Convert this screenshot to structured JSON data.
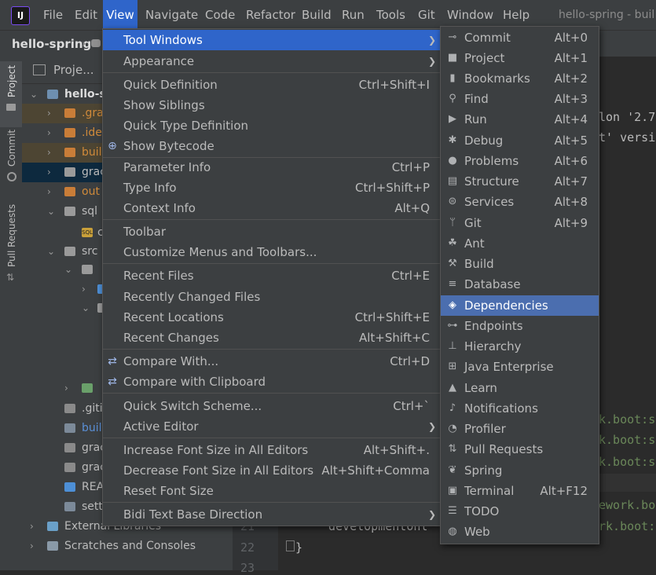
{
  "window": {
    "title": "hello-spring - buil"
  },
  "menubar": {
    "items": [
      {
        "label": "File"
      },
      {
        "label": "Edit"
      },
      {
        "label": "View"
      },
      {
        "label": "Navigate"
      },
      {
        "label": "Code"
      },
      {
        "label": "Refactor"
      },
      {
        "label": "Build"
      },
      {
        "label": "Run"
      },
      {
        "label": "Tools"
      },
      {
        "label": "Git"
      },
      {
        "label": "Window"
      },
      {
        "label": "Help"
      }
    ]
  },
  "navbar": {
    "project": "hello-spring"
  },
  "left_strip": {
    "project": "Project",
    "commit": "Commit",
    "pull_requests": "Pull Requests"
  },
  "project_pane": {
    "title": "Proje...",
    "rows": [
      {
        "label": "hello-s",
        "color": "#dcdcdc"
      },
      {
        "label": ".gra",
        "color": "#d08a3a"
      },
      {
        "label": ".ide",
        "color": "#d08a3a"
      },
      {
        "label": "buil",
        "color": "#d08a3a"
      },
      {
        "label": "grac",
        "color": "#bbbbbb"
      },
      {
        "label": "out",
        "color": "#d08a3a"
      },
      {
        "label": "sql",
        "color": "#bbbbbb"
      },
      {
        "label": "c",
        "color": "#bbbbbb"
      },
      {
        "label": "src",
        "color": "#bbbbbb"
      },
      {
        "label": ".giti",
        "color": "#bbbbbb"
      },
      {
        "label": "buil",
        "color": "#5a8fd6"
      },
      {
        "label": "grac",
        "color": "#bbbbbb"
      },
      {
        "label": "grac",
        "color": "#bbbbbb"
      },
      {
        "label": "REA",
        "color": "#bbbbbb"
      },
      {
        "label": "sett",
        "color": "#bbbbbb"
      },
      {
        "label": "External Libraries",
        "color": "#bbbbbb"
      },
      {
        "label": "Scratches and Consoles",
        "color": "#bbbbbb"
      }
    ]
  },
  "editor": {
    "line_numbers": [
      "21",
      "22",
      "23"
    ],
    "fragments": [
      {
        "text": "lon '2.7",
        "color": "#bbbbbb"
      },
      {
        "text": "t' versi",
        "color": "#bbbbbb"
      },
      {
        "text": "k.boot:s",
        "color": "#6a8759"
      },
      {
        "text": "k.boot:s",
        "color": "#6a8759"
      },
      {
        "text": "k.boot:s",
        "color": "#6a8759"
      },
      {
        "text": "ework.bo",
        "color": "#6a8759"
      },
      {
        "text": "developmentOnl",
        "color": "#bbbbbb"
      },
      {
        "text": "rk.boot:",
        "color": "#6a8759"
      },
      {
        "text": "}",
        "color": "#bbbbbb"
      }
    ]
  },
  "view_menu": {
    "items": [
      {
        "label": "Tool Windows",
        "shortcut": "",
        "submenu": true,
        "selected": true
      },
      {
        "label": "Appearance",
        "shortcut": "",
        "submenu": true
      },
      {
        "label": "Quick Definition",
        "shortcut": "Ctrl+Shift+I"
      },
      {
        "label": "Show Siblings",
        "shortcut": ""
      },
      {
        "label": "Quick Type Definition",
        "shortcut": ""
      },
      {
        "label": "Show Bytecode",
        "shortcut": "",
        "icon": "bytecode-icon"
      },
      {
        "label": "Parameter Info",
        "shortcut": "Ctrl+P"
      },
      {
        "label": "Type Info",
        "shortcut": "Ctrl+Shift+P"
      },
      {
        "label": "Context Info",
        "shortcut": "Alt+Q"
      },
      {
        "label": "Toolbar",
        "shortcut": ""
      },
      {
        "label": "Customize Menus and Toolbars...",
        "shortcut": ""
      },
      {
        "label": "Recent Files",
        "shortcut": "Ctrl+E"
      },
      {
        "label": "Recently Changed Files",
        "shortcut": ""
      },
      {
        "label": "Recent Locations",
        "shortcut": "Ctrl+Shift+E"
      },
      {
        "label": "Recent Changes",
        "shortcut": "Alt+Shift+C"
      },
      {
        "label": "Compare With...",
        "shortcut": "Ctrl+D",
        "icon": "compare-icon"
      },
      {
        "label": "Compare with Clipboard",
        "shortcut": "",
        "icon": "compare-clipboard-icon"
      },
      {
        "label": "Quick Switch Scheme...",
        "shortcut": "Ctrl+`"
      },
      {
        "label": "Active Editor",
        "shortcut": "",
        "submenu": true
      },
      {
        "label": "Increase Font Size in All Editors",
        "shortcut": "Alt+Shift+."
      },
      {
        "label": "Decrease Font Size in All Editors",
        "shortcut": "Alt+Shift+Comma"
      },
      {
        "label": "Reset Font Size",
        "shortcut": ""
      },
      {
        "label": "Bidi Text Base Direction",
        "shortcut": "",
        "submenu": true
      }
    ]
  },
  "tool_windows_menu": {
    "items": [
      {
        "label": "Commit",
        "shortcut": "Alt+0",
        "icon": "commit-icon"
      },
      {
        "label": "Project",
        "shortcut": "Alt+1",
        "icon": "folder-icon"
      },
      {
        "label": "Bookmarks",
        "shortcut": "Alt+2",
        "icon": "bookmark-icon"
      },
      {
        "label": "Find",
        "shortcut": "Alt+3",
        "icon": "search-icon"
      },
      {
        "label": "Run",
        "shortcut": "Alt+4",
        "icon": "play-icon"
      },
      {
        "label": "Debug",
        "shortcut": "Alt+5",
        "icon": "bug-icon"
      },
      {
        "label": "Problems",
        "shortcut": "Alt+6",
        "icon": "problems-icon"
      },
      {
        "label": "Structure",
        "shortcut": "Alt+7",
        "icon": "structure-icon"
      },
      {
        "label": "Services",
        "shortcut": "Alt+8",
        "icon": "services-icon"
      },
      {
        "label": "Git",
        "shortcut": "Alt+9",
        "icon": "git-branch-icon"
      },
      {
        "label": "Ant",
        "shortcut": "",
        "icon": "ant-icon"
      },
      {
        "label": "Build",
        "shortcut": "",
        "icon": "hammer-icon"
      },
      {
        "label": "Database",
        "shortcut": "",
        "icon": "database-icon"
      },
      {
        "label": "Dependencies",
        "shortcut": "",
        "icon": "layers-icon",
        "selected": true
      },
      {
        "label": "Endpoints",
        "shortcut": "",
        "icon": "endpoints-icon"
      },
      {
        "label": "Hierarchy",
        "shortcut": "",
        "icon": "hierarchy-icon"
      },
      {
        "label": "Java Enterprise",
        "shortcut": "",
        "icon": "java-enterprise-icon"
      },
      {
        "label": "Learn",
        "shortcut": "",
        "icon": "graduation-cap-icon"
      },
      {
        "label": "Notifications",
        "shortcut": "",
        "icon": "bell-icon"
      },
      {
        "label": "Profiler",
        "shortcut": "",
        "icon": "profiler-icon"
      },
      {
        "label": "Pull Requests",
        "shortcut": "",
        "icon": "pull-request-icon"
      },
      {
        "label": "Spring",
        "shortcut": "",
        "icon": "spring-leaf-icon"
      },
      {
        "label": "Terminal",
        "shortcut": "Alt+F12",
        "icon": "terminal-icon"
      },
      {
        "label": "TODO",
        "shortcut": "",
        "icon": "todo-list-icon"
      },
      {
        "label": "Web",
        "shortcut": "",
        "icon": "globe-icon"
      }
    ]
  },
  "colors": {
    "menubar_bg": "#3c3f41",
    "selection": "#2f65ca",
    "submenu_selection": "#4b6eaf"
  }
}
